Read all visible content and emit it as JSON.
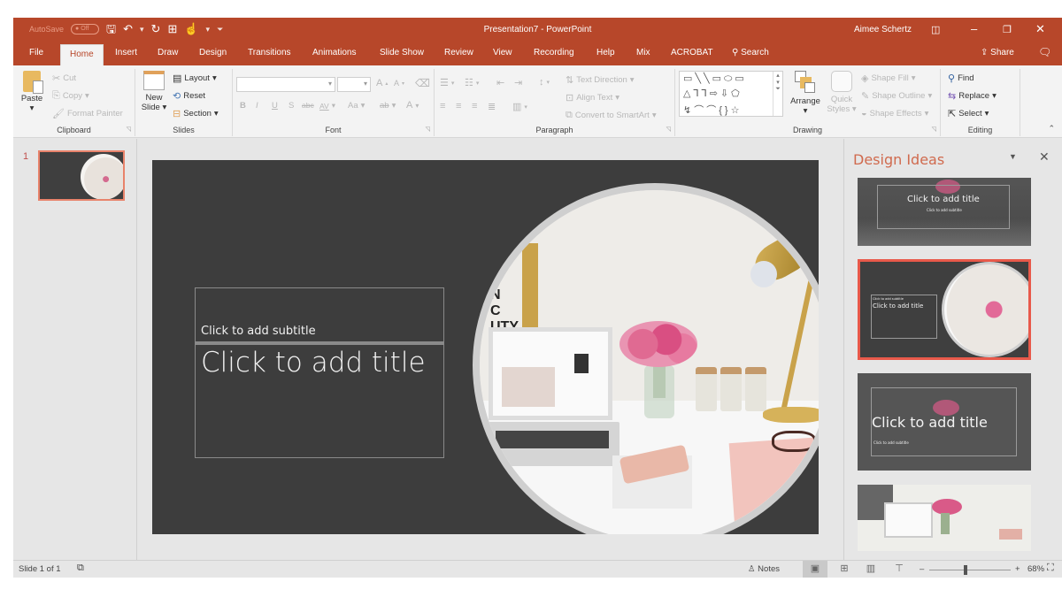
{
  "window": {
    "autosave_label": "AutoSave",
    "autosave_state": "Off",
    "title": "Presentation7 - PowerPoint",
    "user": "Aimee Schertz",
    "qat_icons": [
      "save-icon",
      "undo-icon",
      "redo-icon",
      "present-icon",
      "touch-mode-icon",
      "customize-icon"
    ],
    "controls": {
      "ribbon_display": "◫",
      "minimize": "–",
      "restore": "❐",
      "close": "✕"
    }
  },
  "tabs": {
    "items": [
      "File",
      "Home",
      "Insert",
      "Draw",
      "Design",
      "Transitions",
      "Animations",
      "Slide Show",
      "Review",
      "View",
      "Recording",
      "Help",
      "Mix",
      "ACROBAT"
    ],
    "active": "Home",
    "search": "Search",
    "share": "Share"
  },
  "ribbon": {
    "clipboard": {
      "label": "Clipboard",
      "paste": "Paste",
      "cut": "Cut",
      "copy": "Copy",
      "format_painter": "Format Painter"
    },
    "slides": {
      "label": "Slides",
      "new_slide_1": "New",
      "new_slide_2": "Slide",
      "layout": "Layout",
      "reset": "Reset",
      "section": "Section"
    },
    "font": {
      "label": "Font",
      "font_name": "",
      "font_size": "",
      "bold": "B",
      "italic": "I",
      "underline": "U",
      "shadow": "S",
      "strike": "abc",
      "spacing": "AV",
      "case": "Aa",
      "highlight": "ab",
      "color": "A",
      "grow": "A",
      "shrink": "A",
      "clear": "A"
    },
    "paragraph": {
      "label": "Paragraph",
      "text_direction": "Text Direction",
      "align_text": "Align Text",
      "convert_smartart": "Convert to SmartArt"
    },
    "drawing": {
      "label": "Drawing",
      "arrange": "Arrange",
      "quick_styles_1": "Quick",
      "quick_styles_2": "Styles",
      "shape_fill": "Shape Fill",
      "shape_outline": "Shape Outline",
      "shape_effects": "Shape Effects",
      "shape_rows": [
        "▭╲╲▭⬭▭",
        "△⅂⅂⇨⇩⬠",
        "↯⌒⌒{}☆"
      ]
    },
    "editing": {
      "label": "Editing",
      "find": "Find",
      "replace": "Replace",
      "select": "Select"
    }
  },
  "thumbnails": [
    {
      "number": "1",
      "selected": true
    }
  ],
  "slide": {
    "subtitle_placeholder": "Click to add subtitle",
    "title_placeholder": "Click to add title",
    "poster_text": "N\nC\nUTY"
  },
  "design_ideas": {
    "title": "Design Ideas",
    "ideas": [
      {
        "title": "Click to add title",
        "subtitle": "Click to add subtitle",
        "selected": false
      },
      {
        "title": "Click to add title",
        "subtitle": "Click to add subtitle",
        "selected": true
      },
      {
        "title": "Click to add title",
        "subtitle": "Click to add subtitle",
        "selected": false
      },
      {
        "title": "",
        "subtitle": "",
        "selected": false
      }
    ]
  },
  "status": {
    "slide_info": "Slide 1 of 1",
    "notes": "Notes",
    "zoom_level": "68%",
    "zoom_minus": "–",
    "zoom_plus": "+",
    "zoom_fraction": 0.45
  },
  "colors": {
    "accent": "#b7472a",
    "pane_title": "#d06a4e",
    "selection": "#e8594a",
    "slide_bg": "#3d3d3d"
  }
}
